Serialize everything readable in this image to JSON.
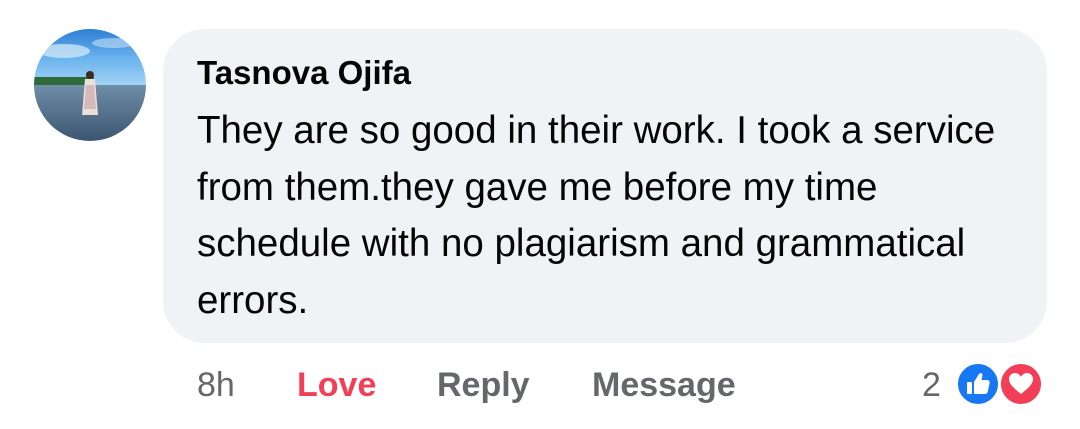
{
  "comment": {
    "author": "Tasnova Ojifa",
    "text": "They are so good in their work. I took a service from them.they gave me before my time schedule with no plagiarism and grammatical errors."
  },
  "actions": {
    "time": "8h",
    "love": "Love",
    "reply": "Reply",
    "message": "Message"
  },
  "reactions": {
    "count": "2",
    "icons": [
      "like-icon",
      "love-icon"
    ]
  },
  "colors": {
    "bubble": "#f0f2f5",
    "love_red": "#f33e58",
    "secondary_text": "#65676b",
    "like_blue": "#1877f2"
  }
}
